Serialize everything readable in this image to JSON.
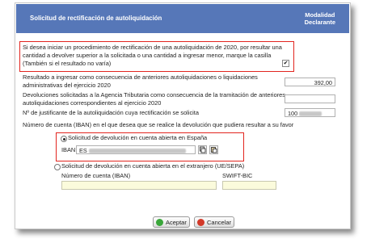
{
  "header": {
    "title": "Solicitud de rectificación de autoliquidación",
    "col_line1": "Modalidad",
    "col_line2": "Declarante"
  },
  "q1": {
    "line1": "Si desea iniciar un procedimiento de rectificación de una autoliquidación de 2020, por resultar una",
    "line2": "cantidad a devolver superior a la solicitada o una cantidad a ingresar menor, marque la casilla",
    "line3": "(También si el resultado no varía)",
    "checked_mark": "✔"
  },
  "resultado": {
    "line1": "Resultado a ingresar como consecuencia de anteriores autoliquidaciones o liquidaciones",
    "line2": "administrativas del ejercicio 2020",
    "value": "392,00"
  },
  "devoluciones": {
    "line1": "Devoluciones solicitadas a la Agencia Tributaria como consecuencia de la tramitación de anteriores",
    "line2": "autoliquidaciones correspondientes al ejercicio 2020",
    "value": ""
  },
  "justificante": {
    "label": "Nº de justificante de la autoliquidación cuya rectificación se solicita",
    "value_prefix": "100"
  },
  "iban_question": "Número de cuenta (IBAN) en el que desea que se realice la devolución que pudiera resultar a su favor",
  "spain_option": {
    "label": "Solicitud de devolución en cuenta abierta en España",
    "iban_label": "IBAN:",
    "iban_prefix": "ES"
  },
  "foreign_option": {
    "label": "Solicitud de devolución en cuenta abierta en el extranjero (UE/SEPA)",
    "account_label": "Número de cuenta (IBAN)",
    "swift_label": "SWIFT-BIC"
  },
  "buttons": {
    "accept": "Aceptar",
    "cancel": "Cancelar"
  },
  "colors": {
    "header": "#5677b8",
    "highlight": "#e2251f",
    "accept_icon": "#3aa63a",
    "cancel_icon": "#d23a2a"
  }
}
